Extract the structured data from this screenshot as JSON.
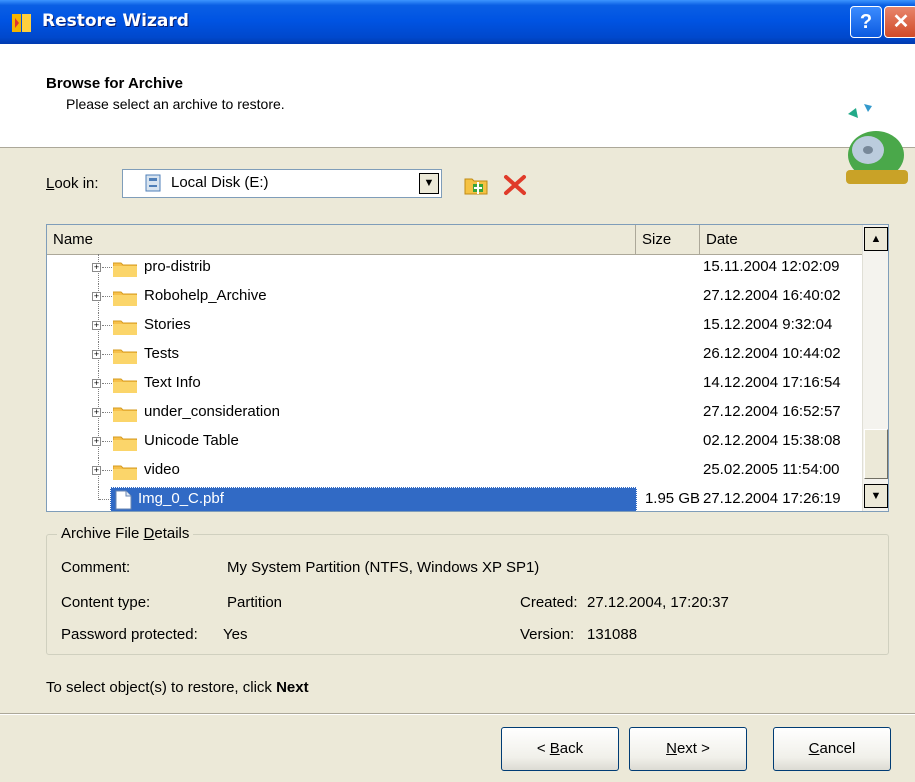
{
  "window": {
    "title": "Restore Wizard",
    "help_label": "?",
    "close_label": "✕"
  },
  "header": {
    "title": "Browse for Archive",
    "subtitle": "Please select an archive to restore."
  },
  "lookin": {
    "label": "Look in:",
    "value": "Local Disk (E:)",
    "icon": "drive-icon"
  },
  "toolbar": {
    "icons": [
      "new-folder-icon",
      "delete-icon"
    ]
  },
  "list": {
    "columns": {
      "name": "Name",
      "size": "Size",
      "date": "Date"
    },
    "rows": [
      {
        "name": "pro-distrib",
        "size": "",
        "date": "15.11.2004 12:02:09",
        "type": "folder"
      },
      {
        "name": "Robohelp_Archive",
        "size": "",
        "date": "27.12.2004 16:40:02",
        "type": "folder"
      },
      {
        "name": "Stories",
        "size": "",
        "date": "15.12.2004 9:32:04",
        "type": "folder"
      },
      {
        "name": "Tests",
        "size": "",
        "date": "26.12.2004 10:44:02",
        "type": "folder"
      },
      {
        "name": "Text Info",
        "size": "",
        "date": "14.12.2004 17:16:54",
        "type": "folder"
      },
      {
        "name": "under_consideration",
        "size": "",
        "date": "27.12.2004 16:52:57",
        "type": "folder"
      },
      {
        "name": "Unicode Table",
        "size": "",
        "date": "02.12.2004 15:38:08",
        "type": "folder"
      },
      {
        "name": "video",
        "size": "",
        "date": "25.02.2005 11:54:00",
        "type": "folder"
      },
      {
        "name": "Img_0_C.pbf",
        "size": "1.95 GB",
        "date": "27.12.2004 17:26:19",
        "type": "file",
        "selected": true
      }
    ]
  },
  "details": {
    "legend": "Archive File Details",
    "comment_label": "Comment:",
    "comment_value": "My System Partition (NTFS, Windows XP SP1)",
    "content_type_label": "Content type:",
    "content_type_value": "Partition",
    "password_label": "Password protected:",
    "password_value": "Yes",
    "created_label": "Created:",
    "created_value": "27.12.2004, 17:20:37",
    "version_label": "Version:",
    "version_value": "131088"
  },
  "hint": {
    "prefix": "To select object(s) to restore, click ",
    "bold": "Next"
  },
  "buttons": {
    "back": "Back",
    "next": "Next",
    "cancel": "Cancel"
  },
  "colors": {
    "title_bar": "#0054e3",
    "selection": "#316ac5",
    "folder": "#f7c04a",
    "dialog_bg": "#ece9d8"
  }
}
